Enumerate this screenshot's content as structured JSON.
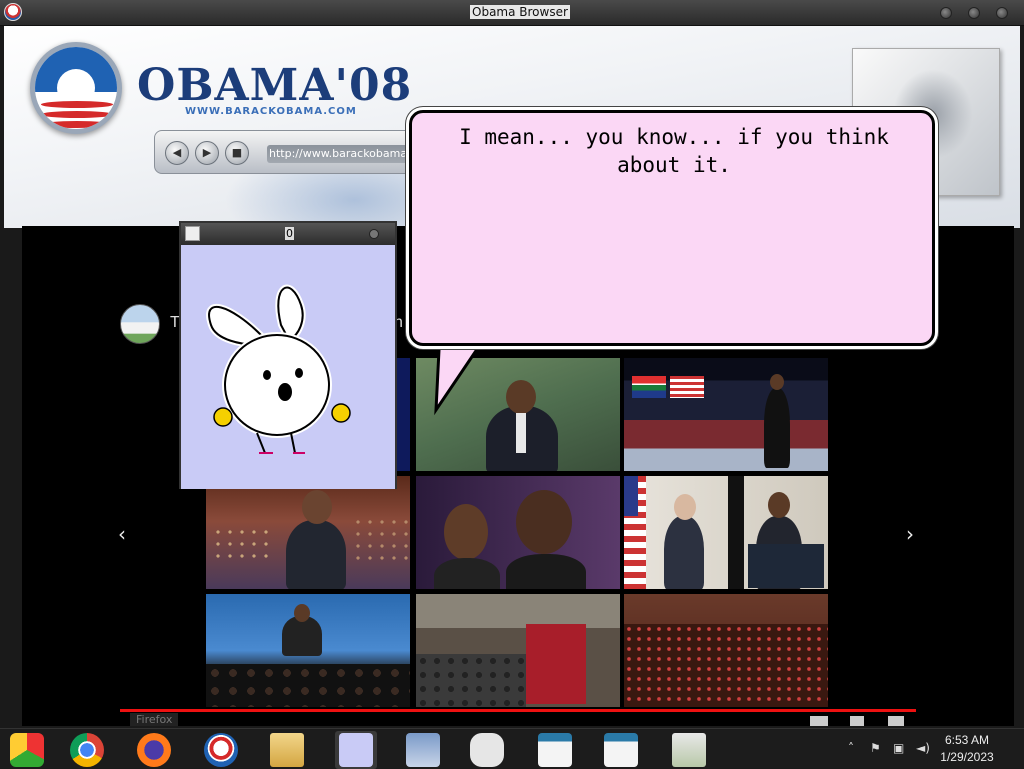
{
  "window": {
    "title": "Obama Browser"
  },
  "browser": {
    "brand_main": "OBAMA'08",
    "brand_url": "WWW.BARACKOBAMA.COM",
    "url": "http://www.barackobama",
    "nav": {
      "back_icon": "back-arrow-icon",
      "forward_icon": "forward-arrow-icon",
      "stop_icon": "stop-icon"
    }
  },
  "content": {
    "channel_letter": "T",
    "channel_suffix": "n",
    "prev_arrow": "‹",
    "next_arrow": "›"
  },
  "pet": {
    "title": "0"
  },
  "speech": {
    "text": "I mean... you know... if you think about it."
  },
  "tooltip": {
    "text": "Firefox"
  },
  "taskbar": {
    "time": "6:53 AM",
    "date": "1/29/2023",
    "apps": [
      "chromium-icon",
      "chrome-icon",
      "firefox-icon",
      "obama-icon",
      "folder-icon",
      "bunny-icon",
      "image-viewer-icon",
      "gamepad-icon",
      "document-icon",
      "document-icon",
      "network-globe-icon"
    ],
    "tray_icons": [
      "up-chevron-icon",
      "flag-icon",
      "network-icon",
      "volume-icon"
    ]
  },
  "colors": {
    "bubble": "#fbd7f5",
    "pet_bg": "#c9cbf6",
    "progress": "#ee1111",
    "brand": "#1c3d7a"
  }
}
